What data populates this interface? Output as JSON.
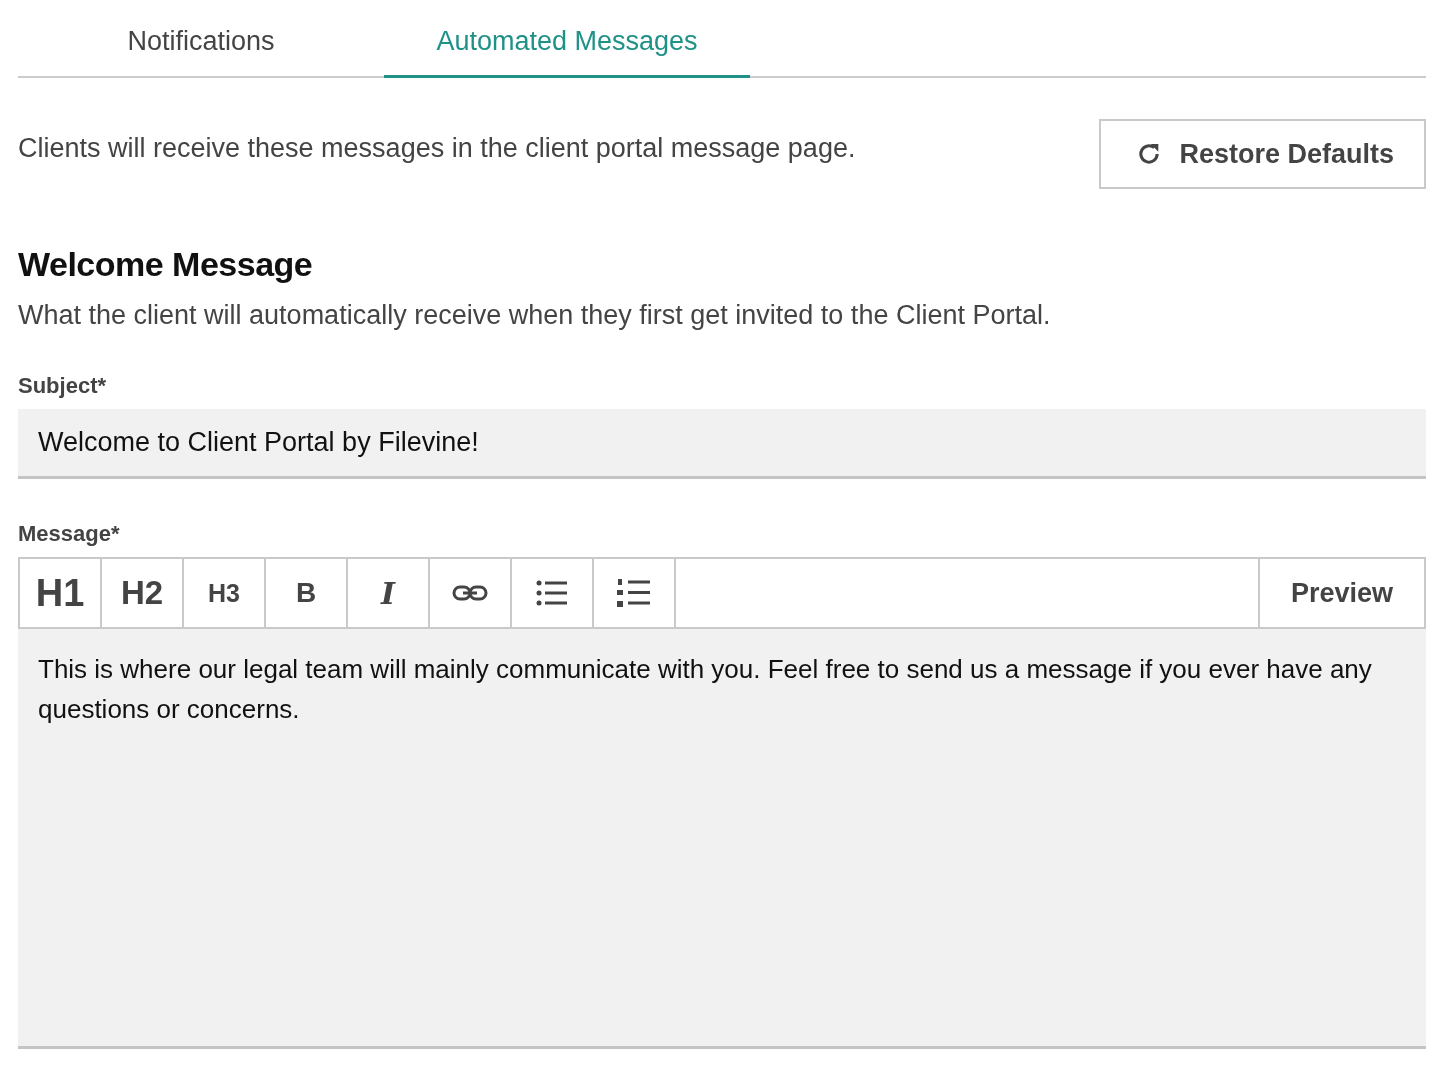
{
  "tabs": [
    {
      "label": "Notifications",
      "selected": false
    },
    {
      "label": "Automated Messages",
      "selected": true
    }
  ],
  "intro": "Clients will receive these messages in the client portal message page.",
  "restore_button": "Restore Defaults",
  "section": {
    "title": "Welcome Message",
    "description": "What the client will automatically receive when they first get invited to the Client Portal."
  },
  "subject": {
    "label": "Subject*",
    "value": "Welcome to Client Portal by Filevine!"
  },
  "message": {
    "label": "Message*",
    "value": "This is where our legal team will mainly communicate with you. Feel free to send us a message if you ever have any questions or concerns."
  },
  "toolbar": [
    {
      "kind": "h1",
      "label": "H1"
    },
    {
      "kind": "h2",
      "label": "H2"
    },
    {
      "kind": "h3",
      "label": "H3"
    },
    {
      "kind": "bold",
      "label": "B"
    },
    {
      "kind": "italic",
      "label": "I"
    },
    {
      "kind": "link"
    },
    {
      "kind": "bullets"
    },
    {
      "kind": "numbers"
    }
  ],
  "preview_button": "Preview"
}
